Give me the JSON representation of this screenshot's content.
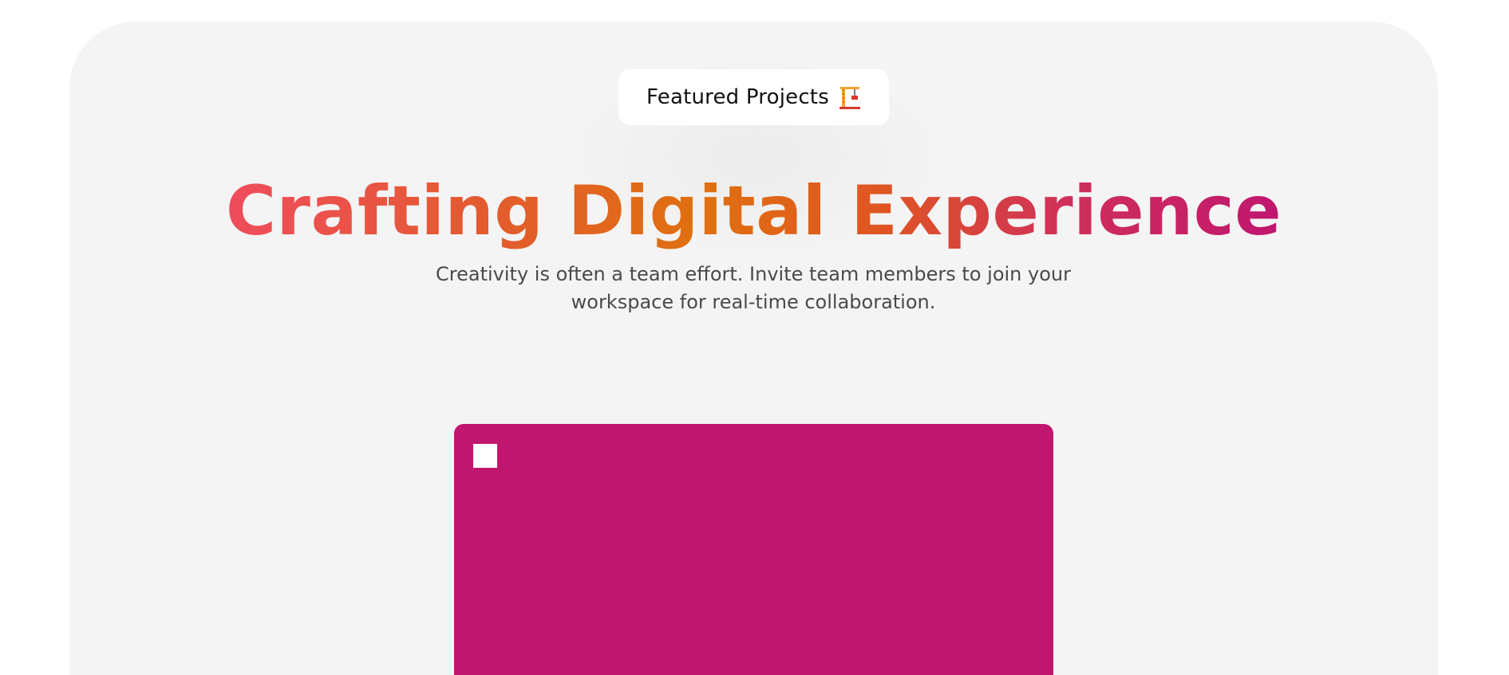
{
  "badge": {
    "label": "Featured Projects",
    "icon": "construction-crane-icon"
  },
  "hero": {
    "title": "Crafting Digital Experience",
    "subtitle_line1": "Creativity is often a team effort. Invite team members to join your",
    "subtitle_line2": "workspace for real-time collaboration."
  },
  "colors": {
    "section_background": "#f4f4f4",
    "title_gradient_start": "#ef4c5c",
    "title_gradient_mid": "#e0700f",
    "title_gradient_end": "#c0166f",
    "card_background": "#c0166f",
    "subtitle_text": "#4a4a4a"
  },
  "card": {
    "icon": "square-icon"
  }
}
